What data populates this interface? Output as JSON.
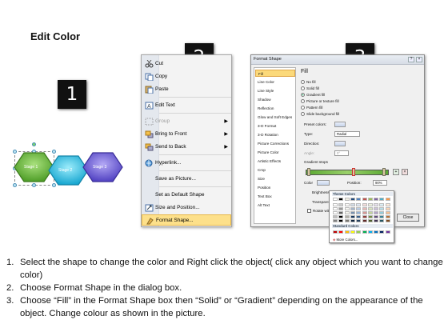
{
  "title": "Edit Color",
  "badges": [
    "1",
    "2",
    "3"
  ],
  "stage_shapes": {
    "labels": [
      "Stage 1",
      "Stage 2",
      "Stage 3"
    ],
    "colors": [
      "#6dbf3a",
      "#35c6e8",
      "#7a6ce0"
    ]
  },
  "context_menu": {
    "items": [
      {
        "label": "Cut",
        "icon": "scissors-icon",
        "disabled": false,
        "submenu": false
      },
      {
        "label": "Copy",
        "icon": "copy-icon",
        "disabled": false,
        "submenu": false
      },
      {
        "label": "Paste",
        "icon": "paste-icon",
        "disabled": false,
        "submenu": false
      },
      {
        "label": "Edit Text",
        "icon": "edit-text-icon",
        "disabled": false,
        "submenu": false
      },
      {
        "label": "Group",
        "icon": "group-icon",
        "disabled": true,
        "submenu": true
      },
      {
        "label": "Bring to Front",
        "icon": "bring-front-icon",
        "disabled": false,
        "submenu": true
      },
      {
        "label": "Send to Back",
        "icon": "send-back-icon",
        "disabled": false,
        "submenu": true
      },
      {
        "label": "Hyperlink...",
        "icon": "hyperlink-icon",
        "disabled": false,
        "submenu": false
      },
      {
        "label": "Save as Picture...",
        "icon": "",
        "disabled": false,
        "submenu": false
      },
      {
        "label": "Set as Default Shape",
        "icon": "",
        "disabled": false,
        "submenu": false
      },
      {
        "label": "Size and Position...",
        "icon": "size-position-icon",
        "disabled": false,
        "submenu": false
      },
      {
        "label": "Format Shape...",
        "icon": "format-shape-icon",
        "disabled": false,
        "submenu": false,
        "highlight": true
      }
    ]
  },
  "format_dialog": {
    "title": "Format Shape",
    "categories": [
      "Fill",
      "Line Color",
      "Line Style",
      "Shadow",
      "Reflection",
      "Glow and Soft Edges",
      "3-D Format",
      "3-D Rotation",
      "Picture Corrections",
      "Picture Color",
      "Artistic Effects",
      "Crop",
      "Size",
      "Position",
      "Text Box",
      "Alt Text"
    ],
    "selected_category": "Fill",
    "pane_title": "Fill",
    "fill_options": [
      "No fill",
      "Solid fill",
      "Gradient fill",
      "Picture or texture fill",
      "Pattern fill",
      "Slide background fill"
    ],
    "selected_fill": "Gradient fill",
    "preset_colors_label": "Preset colors:",
    "type_label": "Type:",
    "type_value": "Radial",
    "direction_label": "Direction:",
    "angle_label": "Angle:",
    "angle_value": "0°",
    "gradient_stops_label": "Gradient stops",
    "color_label": "Color",
    "position_label": "Position:",
    "position_value": "90%",
    "brightness_label": "Brightness:",
    "transparency_label": "Transparency:",
    "rotate_label": "Rotate with shape",
    "close_label": "Close"
  },
  "palette": {
    "theme_header": "Theme Colors",
    "standard_header": "Standard Colors",
    "more_colors": "More Colors...",
    "theme_top": [
      "#ffffff",
      "#000000",
      "#eeece1",
      "#1f497d",
      "#4f81bd",
      "#c0504d",
      "#9bbb59",
      "#8064a2",
      "#4bacc6",
      "#f79646"
    ],
    "standard": [
      "#c00000",
      "#ff0000",
      "#ffc000",
      "#ffff00",
      "#92d050",
      "#00b050",
      "#00b0f0",
      "#0070c0",
      "#002060",
      "#7030a0"
    ]
  },
  "instructions": [
    {
      "n": "1.",
      "text": "Select the shape to change the color and Right click the object( click any object which you want to change color)"
    },
    {
      "n": "2.",
      "text": "Choose Format Shape in the dialog box."
    },
    {
      "n": "3.",
      "text": "Choose “Fill” in the Format Shape box then “Solid” or “Gradient” depending on the appearance of the object. Change colour as shown in the picture."
    }
  ]
}
